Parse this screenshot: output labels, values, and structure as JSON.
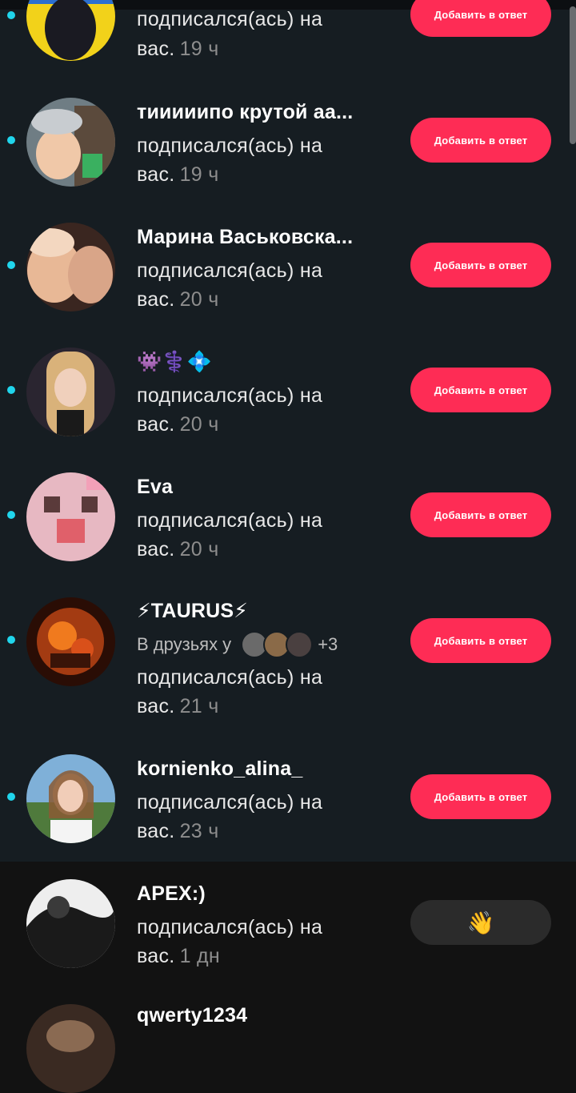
{
  "action_add": "Добавить в ответ",
  "wave_emoji": "👋",
  "rows": [
    {
      "name": "",
      "line1": "подписался(ась) на",
      "line2": "вас.",
      "time": "19 ч"
    },
    {
      "name": "тииииипо крутой аа...",
      "line1": "подписался(ась) на",
      "line2": "вас.",
      "time": "19 ч"
    },
    {
      "name": "Марина Васьковска...",
      "line1": "подписался(ась) на",
      "line2": "вас.",
      "time": "20 ч"
    },
    {
      "name": "👾⚕️💠",
      "line1": "подписался(ась) на",
      "line2": "вас.",
      "time": "20 ч"
    },
    {
      "name": "Eva",
      "line1": "подписался(ась) на",
      "line2": "вас.",
      "time": "20 ч"
    },
    {
      "name": "⚡TAURUS⚡",
      "friends": "В друзьях у",
      "friends_count": "+3",
      "line1": "подписался(ась) на",
      "line2": "вас.",
      "time": "21 ч"
    },
    {
      "name": "kornienko_alina_",
      "line1": "подписался(ась) на",
      "line2": "вас.",
      "time": "23 ч"
    },
    {
      "name": "APEX:)",
      "line1": "подписался(ась) на",
      "line2": "вас.",
      "time": "1 дн"
    },
    {
      "name": "qwerty1234"
    }
  ],
  "colors": {
    "accent": "#fe2c55",
    "unread_dot": "#20d5ec",
    "bg_unread": "#161d22",
    "bg_read": "#121212"
  }
}
